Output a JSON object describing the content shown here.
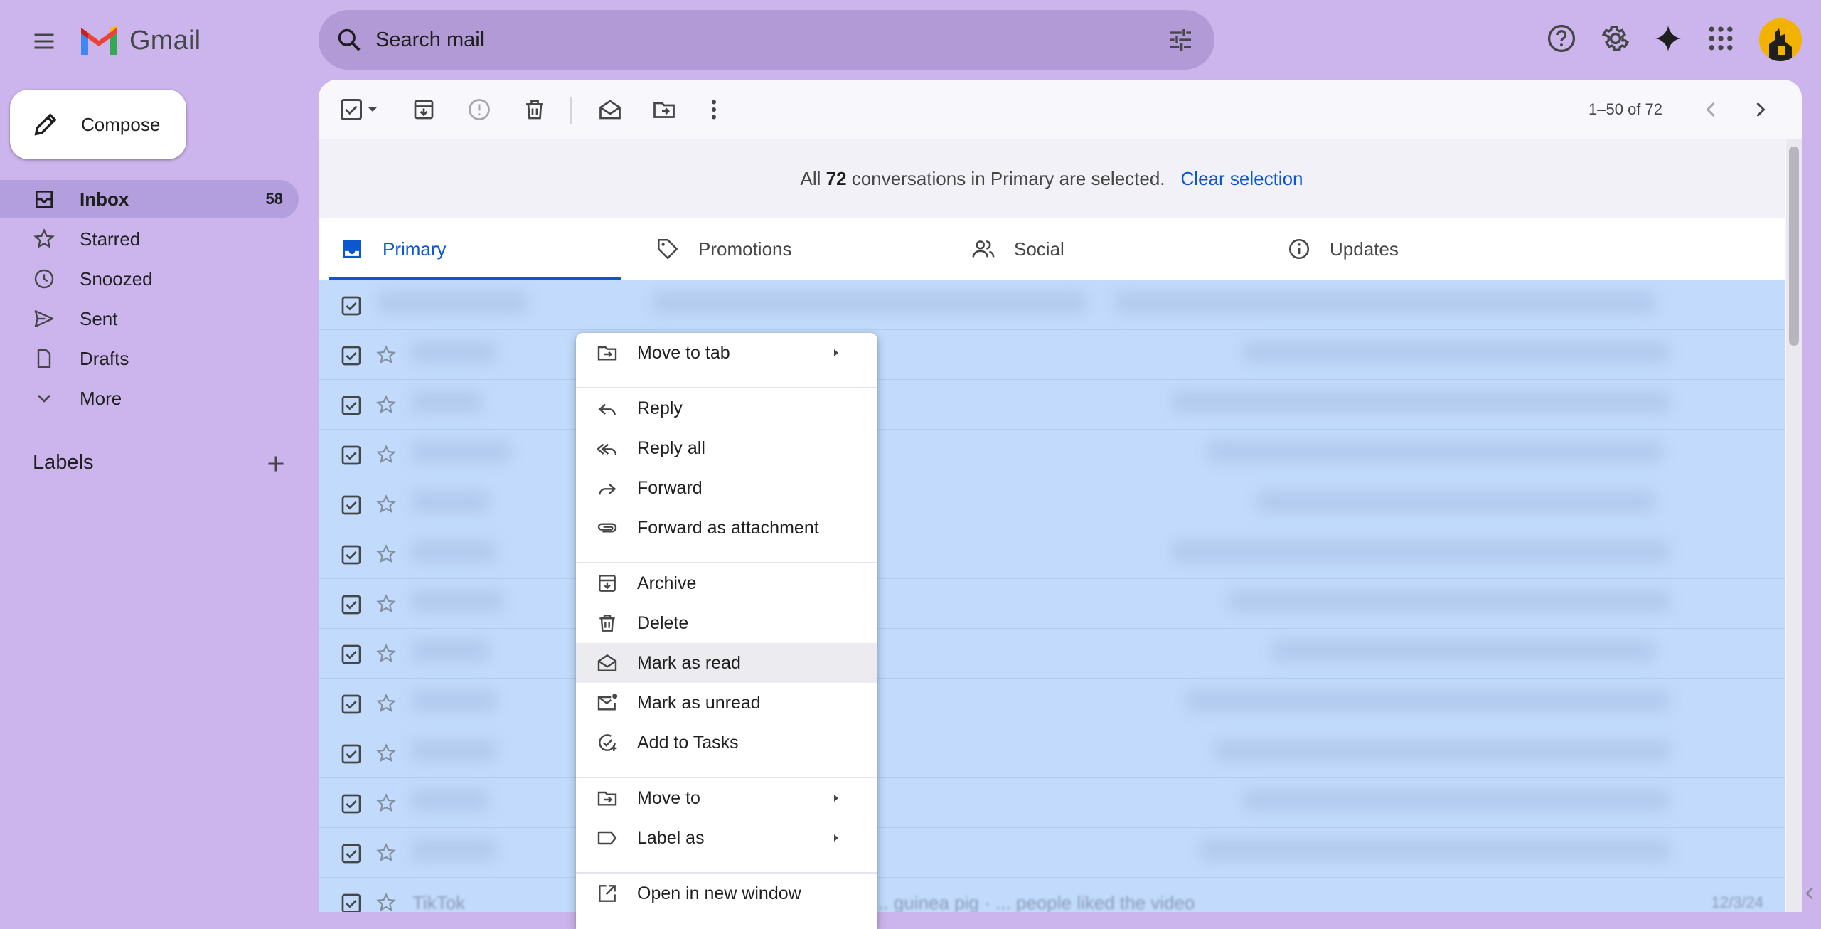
{
  "header": {
    "app_name": "Gmail",
    "search_placeholder": "Search mail"
  },
  "sidebar": {
    "compose_label": "Compose",
    "items": [
      {
        "label": "Inbox",
        "count": "58",
        "icon": "inbox-icon",
        "active": true
      },
      {
        "label": "Starred",
        "icon": "star-icon"
      },
      {
        "label": "Snoozed",
        "icon": "clock-icon"
      },
      {
        "label": "Sent",
        "icon": "send-icon"
      },
      {
        "label": "Drafts",
        "icon": "draft-icon"
      },
      {
        "label": "More",
        "icon": "chevron-down-icon"
      }
    ],
    "labels_title": "Labels"
  },
  "toolbar": {
    "page_info": "1–50 of 72"
  },
  "selection_banner": {
    "prefix": "All",
    "count": "72",
    "suffix": "conversations in Primary are selected.",
    "clear_label": "Clear selection"
  },
  "tabs": [
    {
      "label": "Primary",
      "icon": "inbox-tab-icon",
      "active": true
    },
    {
      "label": "Promotions",
      "icon": "tag-icon"
    },
    {
      "label": "Social",
      "icon": "people-icon"
    },
    {
      "label": "Updates",
      "icon": "info-icon"
    }
  ],
  "email_rows": {
    "last_sender": "TikTok",
    "last_subject": "... guinea pig · ... people liked the video",
    "last_date": "12/3/24"
  },
  "context_menu": {
    "items": [
      {
        "label": "Move to tab",
        "icon": "move-to-tab-icon",
        "submenu": true
      },
      {
        "label": "Reply",
        "icon": "reply-icon"
      },
      {
        "label": "Reply all",
        "icon": "reply-all-icon"
      },
      {
        "label": "Forward",
        "icon": "forward-icon"
      },
      {
        "label": "Forward as attachment",
        "icon": "attachment-icon"
      },
      {
        "label": "Archive",
        "icon": "archive-icon"
      },
      {
        "label": "Delete",
        "icon": "trash-icon"
      },
      {
        "label": "Mark as read",
        "icon": "mark-read-icon",
        "highlighted": true
      },
      {
        "label": "Mark as unread",
        "icon": "mark-unread-icon"
      },
      {
        "label": "Add to Tasks",
        "icon": "add-task-icon"
      },
      {
        "label": "Move to",
        "icon": "move-to-icon",
        "submenu": true
      },
      {
        "label": "Label as",
        "icon": "label-icon",
        "submenu": true
      },
      {
        "label": "Open in new window",
        "icon": "open-new-window-icon"
      }
    ]
  },
  "colors": {
    "background": "#cbb5ec",
    "accent": "#0b57d0",
    "selected_rows": "#c2dbfc",
    "inbox_active": "#b49fde"
  }
}
